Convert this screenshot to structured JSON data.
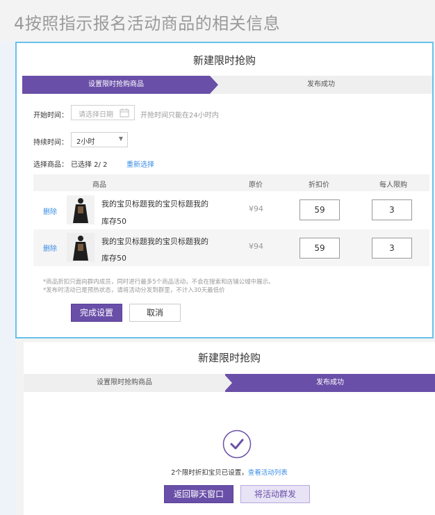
{
  "header": {
    "title": "4按照指示报名活动商品的相关信息"
  },
  "panel1": {
    "title": "新建限时抢购",
    "steps": [
      {
        "label": "设置限时抢购商品"
      },
      {
        "label": "发布成功"
      }
    ],
    "start_time": {
      "label": "开始时间：",
      "placeholder": "请选择日期",
      "hint": "开抢时间只能在24小时内"
    },
    "duration": {
      "label": "持续时间：",
      "value": "2小时"
    },
    "selection": {
      "label": "选择商品：",
      "value": "已选择  2/ 2",
      "reselect": "重新选择"
    },
    "table": {
      "headers": [
        "商品",
        "原价",
        "折扣价",
        "每人限购"
      ],
      "rows": [
        {
          "delete": "删除",
          "title": "我的宝贝标题我的宝贝标题我的",
          "stock": "库存50",
          "price": "¥94",
          "discount": "59",
          "limit": "3"
        },
        {
          "delete": "删除",
          "title": "我的宝贝标题我的宝贝标题我的",
          "stock": "库存50",
          "price": "¥94",
          "discount": "59",
          "limit": "3"
        }
      ]
    },
    "notes": [
      "*商品折扣只面向群内成员，同时进行最多5个商品活动，不会在搜索和店铺公域中展示。",
      "*发布时活动已是预热状态，请将活动分发到群里，不计入30天最低价"
    ],
    "buttons": {
      "confirm": "完成设置",
      "cancel": "取消"
    }
  },
  "panel2": {
    "title": "新建限时抢购",
    "steps": [
      {
        "label": "设置限时抢购商品"
      },
      {
        "label": "发布成功"
      }
    ],
    "success_text": "2个限时折扣宝贝已设置，",
    "success_link": "查看活动列表",
    "buttons": {
      "back": "返回聊天窗口",
      "share": "将活动群发"
    }
  },
  "colors": {
    "accent": "#6a4fa8",
    "panel_border": "#66c2ec",
    "link": "#3a8ee6"
  }
}
